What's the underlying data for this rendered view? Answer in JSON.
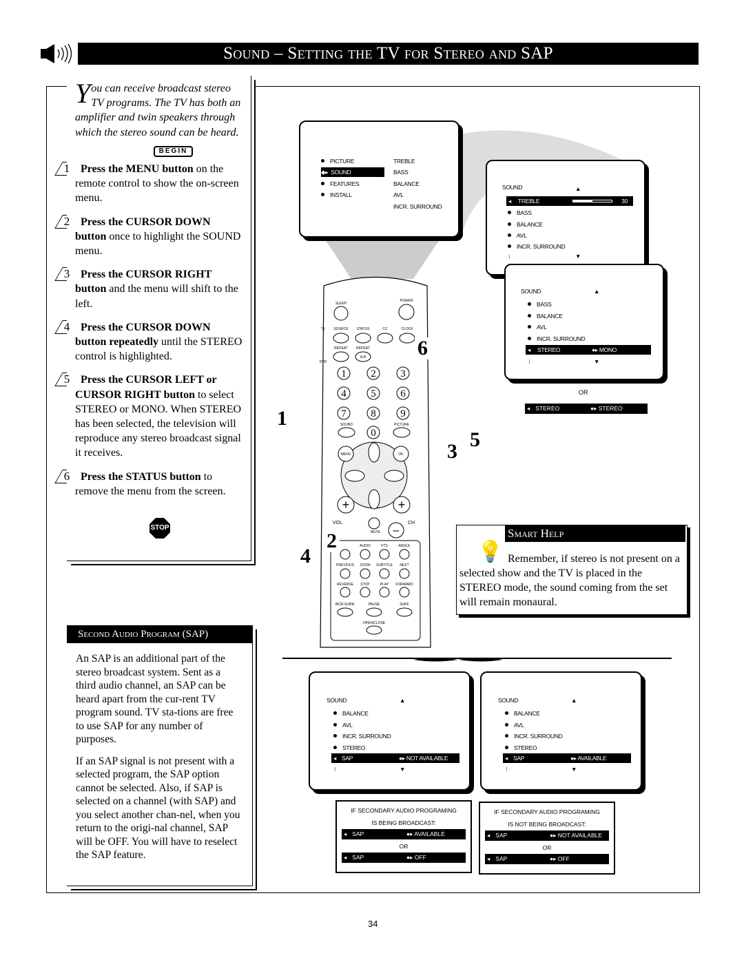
{
  "header": {
    "title": "Sound – Setting the TV for Stereo and SAP",
    "icon": "speaker-icon"
  },
  "intro": {
    "dropcap": "Y",
    "text": "ou can receive broadcast stereo TV programs.  The TV has both an amplifier and twin speakers through which the stereo sound can be heard.",
    "begin": "BEGIN"
  },
  "steps": [
    {
      "n": "1",
      "bold": "Press the MENU button",
      "rest": " on the remote control to show the on-screen menu."
    },
    {
      "n": "2",
      "bold": "Press the CURSOR DOWN button",
      "rest": " once to highlight the SOUND menu."
    },
    {
      "n": "3",
      "bold": "Press the CURSOR RIGHT button",
      "rest": " and the menu will shift to the left."
    },
    {
      "n": "4",
      "bold": "Press the CURSOR DOWN button repeatedly",
      "rest": " until the STEREO control is highlighted."
    },
    {
      "n": "5",
      "bold": "Press the CURSOR LEFT or CURSOR RIGHT button",
      "rest": " to select STEREO or MONO.  When STEREO has been selected, the television will reproduce any stereo broadcast signal it receives."
    },
    {
      "n": "6",
      "bold": "Press the STATUS button",
      "rest": " to remove the menu from the screen."
    }
  ],
  "stop": "STOP",
  "sap": {
    "title": "Second Audio Program (SAP)",
    "p1": "An SAP is an additional part of the stereo broadcast system.  Sent as a third audio channel, an SAP can be heard apart from the cur-rent TV program sound.  TV sta-tions are free to use SAP for any number of purposes.",
    "p2": "If an SAP signal is not present with a selected program, the SAP option cannot be selected.  Also, if SAP is selected on a channel (with SAP) and you select another chan-nel, when you return to the origi-nal channel, SAP will be OFF. You will have to reselect the SAP feature."
  },
  "screen1": {
    "left": [
      "PICTURE",
      "SOUND",
      "FEATURES",
      "INSTALL"
    ],
    "right": [
      "TREBLE",
      "BASS",
      "BALANCE",
      "AVL",
      "INCR. SURROUND"
    ]
  },
  "screen2": {
    "title": "SOUND",
    "items": [
      "TREBLE",
      "BASS",
      "BALANCE",
      "AVL",
      "INCR. SURROUND"
    ],
    "treble_value": "30",
    "treble_level": 0.5
  },
  "screen3": {
    "title": "SOUND",
    "items": [
      "BASS",
      "BALANCE",
      "AVL",
      "INCR. SURROUND",
      "STEREO"
    ],
    "stereo_value": "MONO"
  },
  "or": "OR",
  "alt_stereo": {
    "label": "STEREO",
    "value": "STEREO"
  },
  "remote": {
    "sleep": "SLEEP",
    "power": "POWER",
    "tv": "TV",
    "dvd": "DVD",
    "row1": [
      "SOURCE",
      "STATUS",
      "CC",
      "CLOCK"
    ],
    "row2": [
      "REPEAT",
      "REPEAT"
    ],
    "ab": "A-B",
    "digits": [
      "1",
      "2",
      "3",
      "4",
      "5",
      "6",
      "7",
      "8",
      "9",
      "0"
    ],
    "sound": "SOUND",
    "picture": "PICTURE",
    "menu": "MENU",
    "ok": "OK",
    "vol": "VOL",
    "ch": "CH",
    "mute": "MUTE",
    "r3": [
      "AUDIO",
      "FTS",
      "ANGLE"
    ],
    "r4": [
      "PREVIOUS",
      "ZOOM",
      "SUBTITLE",
      "NEXT"
    ],
    "r5": [
      "REVERSE",
      "STOP",
      "PLAY",
      "FORWARD"
    ],
    "r6": [
      "INCR.SURR.",
      "PAUSE",
      "SURF"
    ],
    "open": "OPEN/CLOSE"
  },
  "callouts": [
    "1",
    "2",
    "3",
    "4",
    "5",
    "6"
  ],
  "smart_help": {
    "title": "Smart Help",
    "text": "Remember, if stereo is not present on a selected show and the TV is placed in the STEREO mode, the sound coming from the set will remain monaural."
  },
  "sap_screen_a": {
    "title": "SOUND",
    "items": [
      "BALANCE",
      "AVL",
      "INCR. SURROUND",
      "STEREO",
      "SAP"
    ],
    "value": "NOT AVAILABLE"
  },
  "sap_screen_b": {
    "title": "SOUND",
    "items": [
      "BALANCE",
      "AVL",
      "INCR. SURROUND",
      "STEREO",
      "SAP"
    ],
    "value": "AVAILABLE"
  },
  "info_a": {
    "line1": "IF SECONDARY AUDIO PROGRAMING",
    "line2": "IS BEING BROADCAST:",
    "opt1": "AVAILABLE",
    "opt2": "OFF",
    "label": "SAP",
    "or": "OR"
  },
  "info_b": {
    "line1": "IF SECONDARY AUDIO PROGRAMING",
    "line2": "IS NOT BEING BROADCAST:",
    "opt1": "NOT AVAILABLE",
    "opt2": "OFF",
    "label": "SAP",
    "or": "OR"
  },
  "page_number": "34"
}
